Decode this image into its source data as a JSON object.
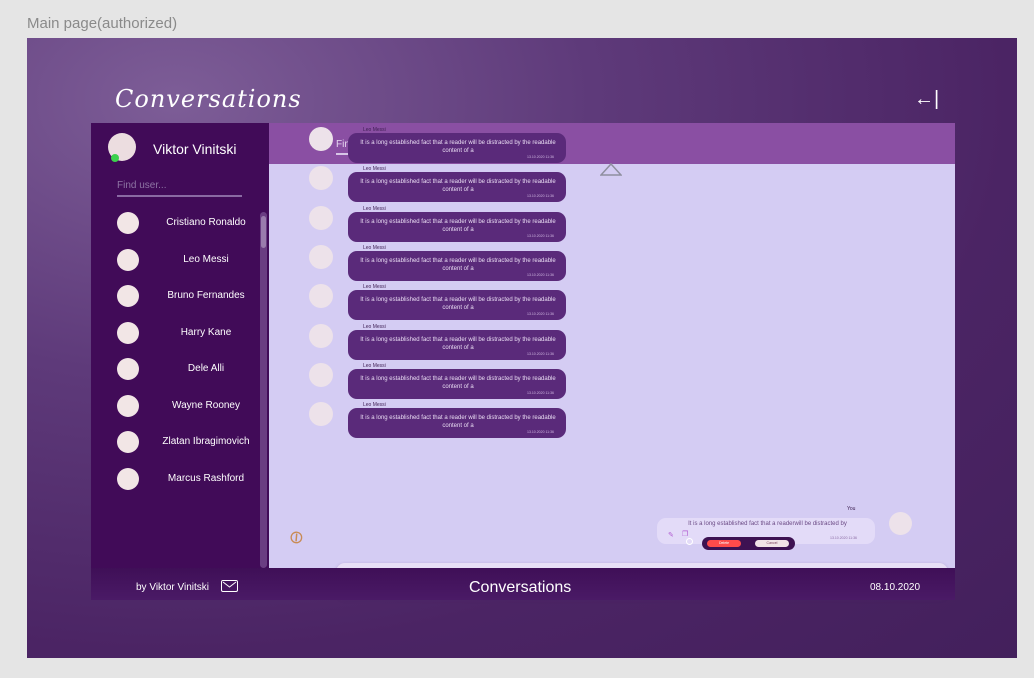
{
  "page_label": "Main page(authorized)",
  "header": {
    "title": "Conversations",
    "logout_icon": "←|"
  },
  "sidebar": {
    "me": {
      "name": "Viktor Vinitski"
    },
    "find_user_placeholder": "Find user...",
    "users": [
      {
        "name": "Cristiano Ronaldo"
      },
      {
        "name": "Leo Messi"
      },
      {
        "name": "Bruno Fernandes"
      },
      {
        "name": "Harry Kane"
      },
      {
        "name": "Dele Alli"
      },
      {
        "name": "Wayne Rooney"
      },
      {
        "name": "Zlatan Ibragimovich"
      },
      {
        "name": "Marcus Rashford"
      }
    ]
  },
  "chat": {
    "find_message_placeholder": "Find message...",
    "messages": [
      {
        "author": "Leo Messi",
        "text": "It is a long established fact that a reader will be distracted by the readable content of a",
        "time": "13.10.2020 11:36"
      },
      {
        "author": "Leo Messi",
        "text": "It is a long established fact that a reader will be distracted by the readable content of a",
        "time": "13.10.2020 11:36"
      },
      {
        "author": "Leo Messi",
        "text": "It is a long established fact that a reader will be distracted by the readable content of a",
        "time": "13.10.2020 11:36"
      },
      {
        "author": "Leo Messi",
        "text": "It is a long established fact that a reader will be distracted by the readable content of a",
        "time": "13.10.2020 11:36"
      },
      {
        "author": "Leo Messi",
        "text": "It is a long established fact that a reader will be distracted by the readable content of a",
        "time": "13.10.2020 11:36"
      },
      {
        "author": "Leo Messi",
        "text": "It is a long established fact that a reader will be distracted by the readable content of a",
        "time": "13.10.2020 11:36"
      },
      {
        "author": "Leo Messi",
        "text": "It is a long established fact that a reader will be distracted by the readable content of a",
        "time": "13.10.2020 11:36"
      },
      {
        "author": "Leo Messi",
        "text": "It is a long established fact that a reader will be distracted by the readable content of a",
        "time": "13.10.2020 11:36"
      }
    ],
    "my_message": {
      "author": "You",
      "text": "It is a long established fact that a readerwill be distracted by",
      "time": "13.10.2020 11:36"
    },
    "confirm": {
      "delete": "Delete",
      "cancel": "Cancel"
    }
  },
  "footer": {
    "author": "by Viktor Vinitski",
    "title": "Conversations",
    "date": "08.10.2020"
  },
  "colors": {
    "accent": "#8a4fa3",
    "sidebar": "#410b58",
    "chat_bg": "#d4ccf3",
    "bubble": "#5a2a7a",
    "online": "#3bd14c",
    "delete": "#ff4b4b",
    "send": "#e8854a"
  }
}
